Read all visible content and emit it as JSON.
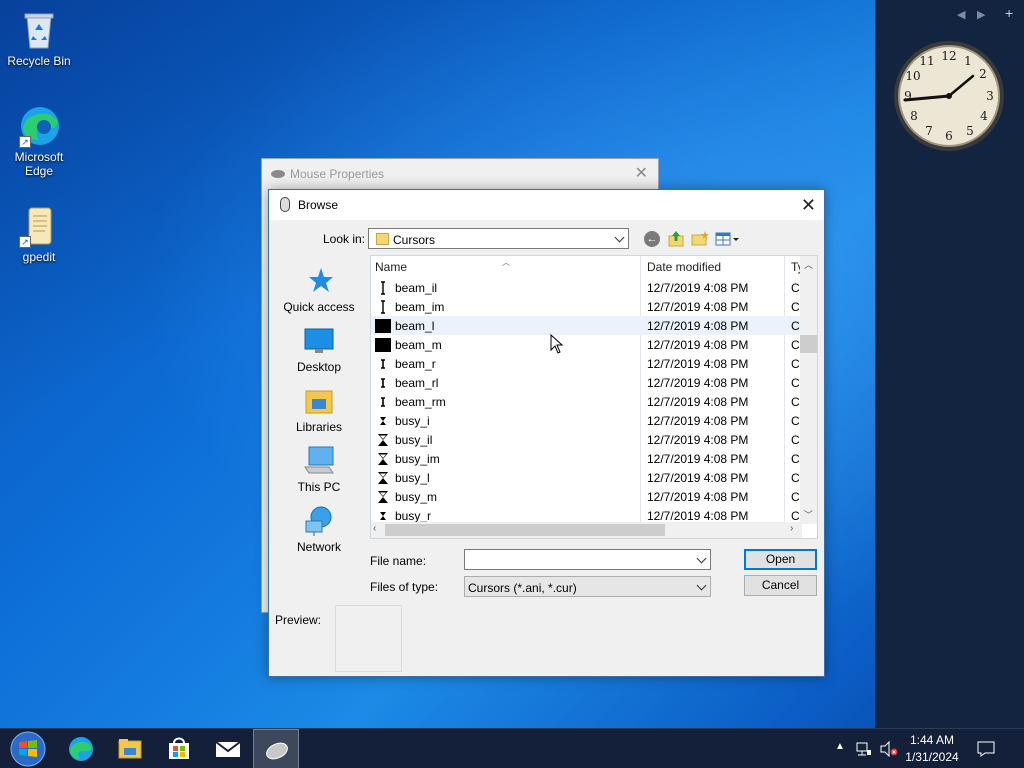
{
  "desktop": {
    "icons": [
      {
        "label": "Recycle Bin"
      },
      {
        "label_line1": "Microsoft",
        "label_line2": "Edge"
      },
      {
        "label": "gpedit"
      }
    ]
  },
  "background_window": {
    "title": "Mouse Properties",
    "close_glyph": "✕"
  },
  "dialog": {
    "title": "Browse",
    "close_glyph": "✕",
    "look_in_label": "Look in:",
    "look_in_value": "Cursors",
    "places": [
      {
        "label": "Quick access",
        "icon": "star-icon"
      },
      {
        "label": "Desktop",
        "icon": "desktop-icon"
      },
      {
        "label": "Libraries",
        "icon": "libraries-icon"
      },
      {
        "label": "This PC",
        "icon": "computer-icon"
      },
      {
        "label": "Network",
        "icon": "network-icon"
      }
    ],
    "columns": {
      "name": "Name",
      "date": "Date modified",
      "type": "Ty"
    },
    "files": [
      {
        "name": "beam_il",
        "date": "12/7/2019 4:08 PM",
        "type": "Cu",
        "icon": "ibeam-thin"
      },
      {
        "name": "beam_im",
        "date": "12/7/2019 4:08 PM",
        "type": "Cu",
        "icon": "ibeam-thin"
      },
      {
        "name": "beam_l",
        "date": "12/7/2019 4:08 PM",
        "type": "Cu",
        "icon": "black-square"
      },
      {
        "name": "beam_m",
        "date": "12/7/2019 4:08 PM",
        "type": "Cu",
        "icon": "black-square"
      },
      {
        "name": "beam_r",
        "date": "12/7/2019 4:08 PM",
        "type": "Cu",
        "icon": "ibeam-small"
      },
      {
        "name": "beam_rl",
        "date": "12/7/2019 4:08 PM",
        "type": "Cu",
        "icon": "ibeam-small"
      },
      {
        "name": "beam_rm",
        "date": "12/7/2019 4:08 PM",
        "type": "Cu",
        "icon": "ibeam-small"
      },
      {
        "name": "busy_i",
        "date": "12/7/2019 4:08 PM",
        "type": "Cu",
        "icon": "hourglass-small"
      },
      {
        "name": "busy_il",
        "date": "12/7/2019 4:08 PM",
        "type": "Cu",
        "icon": "hourglass"
      },
      {
        "name": "busy_im",
        "date": "12/7/2019 4:08 PM",
        "type": "Cu",
        "icon": "hourglass"
      },
      {
        "name": "busy_l",
        "date": "12/7/2019 4:08 PM",
        "type": "Cu",
        "icon": "hourglass"
      },
      {
        "name": "busy_m",
        "date": "12/7/2019 4:08 PM",
        "type": "Cu",
        "icon": "hourglass"
      },
      {
        "name": "busy_r",
        "date": "12/7/2019 4:08 PM",
        "type": "Cu",
        "icon": "hourglass-small"
      }
    ],
    "file_name_label": "File name:",
    "file_name_value": "",
    "files_of_type_label": "Files of type:",
    "files_of_type_value": "Cursors (*.ani, *.cur)",
    "open_label": "Open",
    "cancel_label": "Cancel",
    "preview_label": "Preview:"
  },
  "taskbar": {
    "time": "1:44 AM",
    "date": "1/31/2024"
  },
  "colors": {
    "selection": "#eaf3fc",
    "accent": "#0078d7",
    "taskbar": "#14203a"
  }
}
